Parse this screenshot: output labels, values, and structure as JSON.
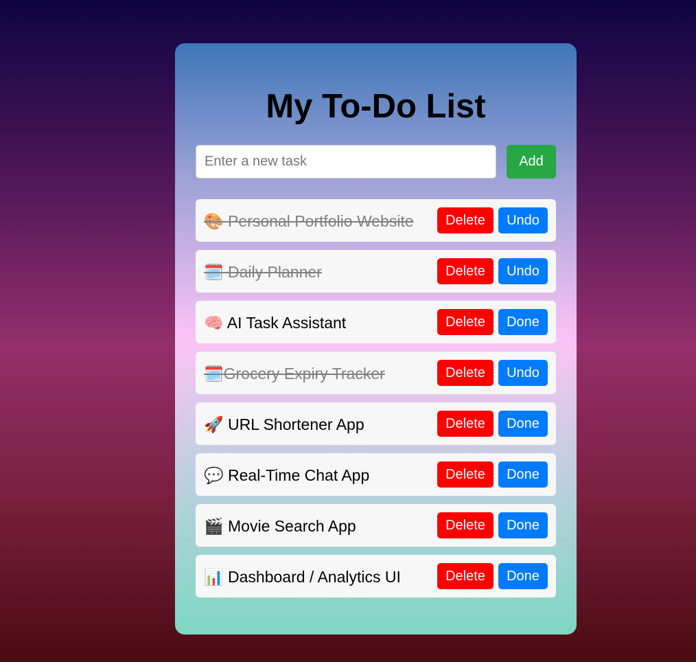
{
  "app": {
    "title": "My To-Do List"
  },
  "input": {
    "placeholder": "Enter a new task",
    "value": "",
    "add_label": "Add"
  },
  "tasks": [
    {
      "text": "🎨 Personal Portfolio Website",
      "completed": true,
      "delete_label": "Delete",
      "toggle_label": "Undo"
    },
    {
      "text": "🗓️ Daily Planner",
      "completed": true,
      "delete_label": "Delete",
      "toggle_label": "Undo"
    },
    {
      "text": "🧠 AI Task Assistant",
      "completed": false,
      "delete_label": "Delete",
      "toggle_label": "Done"
    },
    {
      "text": "🗓️Grocery Expiry Tracker",
      "completed": true,
      "delete_label": "Delete",
      "toggle_label": "Undo"
    },
    {
      "text": "🚀 URL Shortener App",
      "completed": false,
      "delete_label": "Delete",
      "toggle_label": "Done"
    },
    {
      "text": "💬 Real-Time Chat App",
      "completed": false,
      "delete_label": "Delete",
      "toggle_label": "Done"
    },
    {
      "text": "🎬 Movie Search App",
      "completed": false,
      "delete_label": "Delete",
      "toggle_label": "Done"
    },
    {
      "text": "📊 Dashboard / Analytics UI",
      "completed": false,
      "delete_label": "Delete",
      "toggle_label": "Done"
    }
  ],
  "colors": {
    "add": "#28a745",
    "delete": "#ff0000",
    "toggle": "#007bff",
    "completed_text": "#808080"
  }
}
